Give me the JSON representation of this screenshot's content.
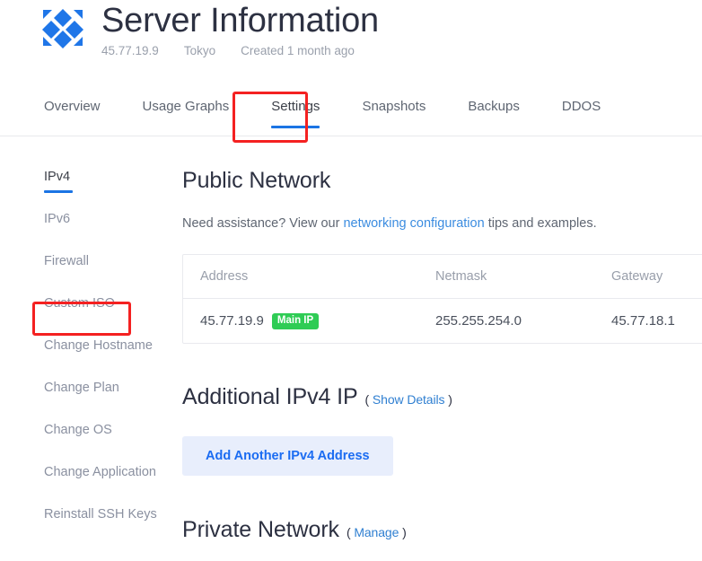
{
  "header": {
    "logo_icon": "vultr-diamond-logo",
    "title": "Server Information",
    "meta": {
      "ip": "45.77.19.9",
      "region": "Tokyo",
      "created": "Created 1 month ago"
    }
  },
  "tabs": [
    {
      "label": "Overview",
      "active": false
    },
    {
      "label": "Usage Graphs",
      "active": false
    },
    {
      "label": "Settings",
      "active": true
    },
    {
      "label": "Snapshots",
      "active": false
    },
    {
      "label": "Backups",
      "active": false
    },
    {
      "label": "DDOS",
      "active": false
    }
  ],
  "sidebar": {
    "items": [
      {
        "label": "IPv4",
        "active": true
      },
      {
        "label": "IPv6",
        "active": false
      },
      {
        "label": "Firewall",
        "active": false
      },
      {
        "label": "Custom ISO",
        "active": false
      },
      {
        "label": "Change Hostname",
        "active": false
      },
      {
        "label": "Change Plan",
        "active": false
      },
      {
        "label": "Change OS",
        "active": false
      },
      {
        "label": "Change Application",
        "active": false
      },
      {
        "label": "Reinstall SSH Keys",
        "active": false
      }
    ]
  },
  "main": {
    "public_network": {
      "title": "Public Network",
      "assist_prefix": "Need assistance? View our",
      "assist_link": "networking configuration",
      "assist_suffix": "tips and examples.",
      "table": {
        "headers": {
          "address": "Address",
          "netmask": "Netmask",
          "gateway": "Gateway"
        },
        "rows": [
          {
            "address": "45.77.19.9",
            "badge": "Main IP",
            "netmask": "255.255.254.0",
            "gateway": "45.77.18.1"
          }
        ]
      }
    },
    "additional_ipv4": {
      "title": "Additional IPv4 IP",
      "paren_open": "(",
      "link": "Show Details",
      "paren_close": ")",
      "add_button": "Add Another IPv4 Address"
    },
    "private_network": {
      "title": "Private Network",
      "paren_open": "(",
      "link": "Manage",
      "paren_close": ")"
    }
  },
  "annotations": [
    {
      "target": "tab-settings",
      "color": "#f42121"
    },
    {
      "target": "sidebar-item-custom-iso",
      "color": "#f42121"
    }
  ],
  "colors": {
    "accent_blue": "#1b74e4",
    "link_blue": "#3b8ce0",
    "badge_green": "#2fcc55",
    "annotation_red": "#f42121",
    "title_dark": "#2d3142",
    "muted_gray": "#8a90a0"
  }
}
